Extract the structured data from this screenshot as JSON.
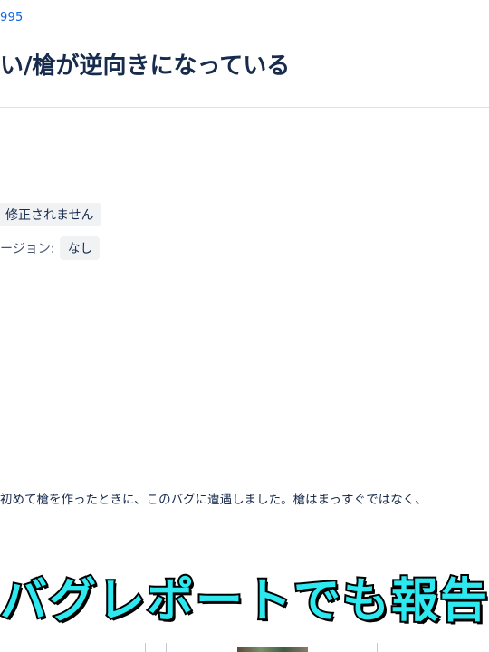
{
  "issue": {
    "key": "995",
    "title": "い/槍が逆向きになっている"
  },
  "fields": {
    "resolution_value": "修正されません",
    "fix_version_label": "ージョン:",
    "fix_version_value": "なし"
  },
  "description": "初めて槍を作ったときに、このバグに遭遇しました。槍はまっすぐではなく、",
  "caption": "バグレポートでも報告され",
  "colors": {
    "link": "#0c66e4",
    "caption_fill": "#2ee8f0",
    "caption_stroke": "#000000"
  }
}
